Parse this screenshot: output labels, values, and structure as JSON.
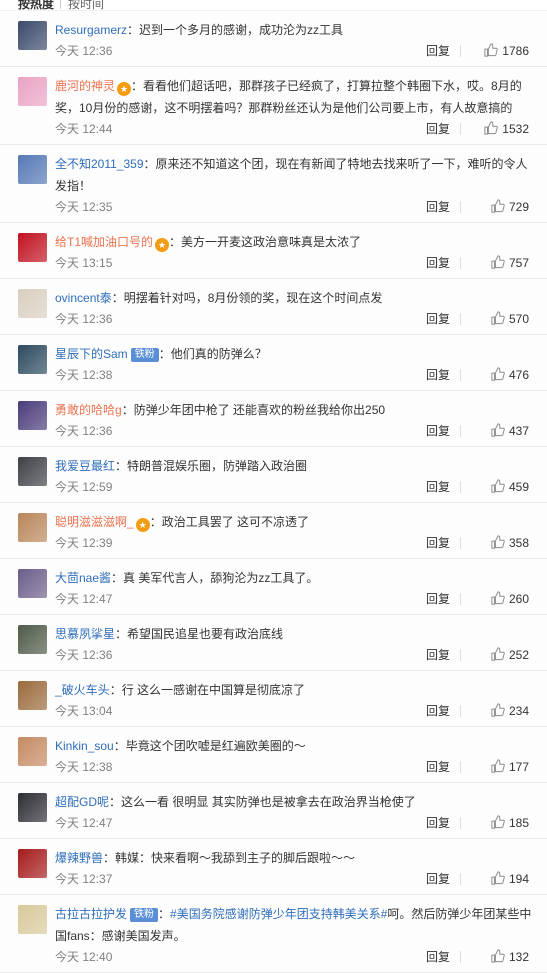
{
  "tabs": [
    {
      "label": "按热度",
      "active": true
    },
    {
      "label": "按时间",
      "active": false
    }
  ],
  "reply_label": "回复",
  "comments": [
    {
      "user": "Resurgamerz",
      "vip": false,
      "badge": "",
      "text": "迟到一个多月的感谢，成功沦为zz工具",
      "time": "今天 12:36",
      "likes": "1786",
      "avatar_color": "#3b4a6b",
      "name_color": "#2f6dbb"
    },
    {
      "user": "鹿河的神灵",
      "vip": true,
      "badge": "",
      "text": "看看他们超话吧，那群孩子已经疯了，打算拉整个韩圈下水，哎。8月的奖，10月份的感谢，这不明摆着吗？那群粉丝还认为是他们公司要上市，有人故意搞的",
      "time": "今天 12:44",
      "likes": "1532",
      "avatar_color": "#e9a3c4",
      "name_color": "#eb7350"
    },
    {
      "user": "全不知2011_359",
      "vip": false,
      "badge": "",
      "text": "原来还不知道这个团，现在有新闻了特地去找来听了一下，难听的令人发指！",
      "time": "今天 12:35",
      "likes": "729",
      "avatar_color": "#5578b5",
      "name_color": "#2f6dbb"
    },
    {
      "user": "给T1喊加油口号的",
      "vip": true,
      "badge": "",
      "text": "美方一开麦这政治意味真是太浓了",
      "time": "今天 13:15",
      "likes": "757",
      "avatar_color": "#c0121f",
      "name_color": "#eb7350"
    },
    {
      "user": "ovincent泰",
      "vip": false,
      "badge": "",
      "text": "明摆着针对吗，8月份领的奖，现在这个时间点发",
      "time": "今天 12:36",
      "likes": "570",
      "avatar_color": "#d9cfc0",
      "name_color": "#2f6dbb"
    },
    {
      "user": "星辰下的Sam",
      "vip": false,
      "badge": "铁粉",
      "text": "他们真的防弹么？",
      "time": "今天 12:38",
      "likes": "476",
      "avatar_color": "#2c4a5e",
      "name_color": "#2f6dbb"
    },
    {
      "user": "勇敢的哈哈g",
      "vip": false,
      "badge": "",
      "text": "防弹少年团中枪了 还能喜欢的粉丝我给你出250",
      "time": "今天 12:36",
      "likes": "437",
      "avatar_color": "#4a3b7a",
      "name_color": "#eb7350"
    },
    {
      "user": "我爱豆最红",
      "vip": false,
      "badge": "",
      "text": "特朗普混娱乐圈，防弹踏入政治圈",
      "time": "今天 12:59",
      "likes": "459",
      "avatar_color": "#3d4046",
      "name_color": "#2f6dbb"
    },
    {
      "user": "聪明滋滋滋啊_",
      "vip": true,
      "badge": "",
      "text": "政治工具罢了 这可不凉透了",
      "time": "今天 12:39",
      "likes": "358",
      "avatar_color": "#b9865a",
      "name_color": "#eb7350"
    },
    {
      "user": "大茴nae酱",
      "vip": false,
      "badge": "",
      "text": "真 美军代言人，舔狗沦为zz工具了。",
      "time": "今天 12:47",
      "likes": "260",
      "avatar_color": "#6b5d8a",
      "name_color": "#2f6dbb"
    },
    {
      "user": "思慕夙挲星",
      "vip": false,
      "badge": "",
      "text": "希望国民追星也要有政治底线",
      "time": "今天 12:36",
      "likes": "252",
      "avatar_color": "#4f5a48",
      "name_color": "#2f6dbb"
    },
    {
      "user": "_破火车头",
      "vip": false,
      "badge": "",
      "text": "行 这么一感谢在中国算是彻底凉了",
      "time": "今天 13:04",
      "likes": "234",
      "avatar_color": "#9a6a3c",
      "name_color": "#2f6dbb"
    },
    {
      "user": "Kinkin_sou",
      "vip": false,
      "badge": "",
      "text": "毕竟这个团吹嘘是红遍欧美圈的～",
      "time": "今天 12:38",
      "likes": "177",
      "avatar_color": "#c58a62",
      "name_color": "#2f6dbb"
    },
    {
      "user": "超配GD呢",
      "vip": false,
      "badge": "",
      "text": "这么一看 很明显 其实防弹也是被拿去在政治界当枪使了",
      "time": "今天 12:47",
      "likes": "185",
      "avatar_color": "#2d2d35",
      "name_color": "#2f6dbb"
    },
    {
      "user": "爆辣野兽",
      "vip": false,
      "badge": "",
      "text": "韩媒：快来看啊～我舔到主子的脚后跟啦～～",
      "time": "今天 12:37",
      "likes": "194",
      "avatar_color": "#a51b1b",
      "name_color": "#2f6dbb"
    },
    {
      "user": "古拉古拉护发",
      "vip": false,
      "badge": "铁粉",
      "hashtag": "#美国务院感谢防弹少年团支持韩美关系#",
      "text": "呵。然后防弹少年团某些中国fans：感谢美国发声。",
      "time": "今天 12:40",
      "likes": "132",
      "avatar_color": "#d8c99a",
      "name_color": "#2f6dbb"
    }
  ],
  "colors": {
    "orange_name": "#eb7350",
    "blue_name": "#2f6dbb",
    "timestamp": "#808080"
  }
}
